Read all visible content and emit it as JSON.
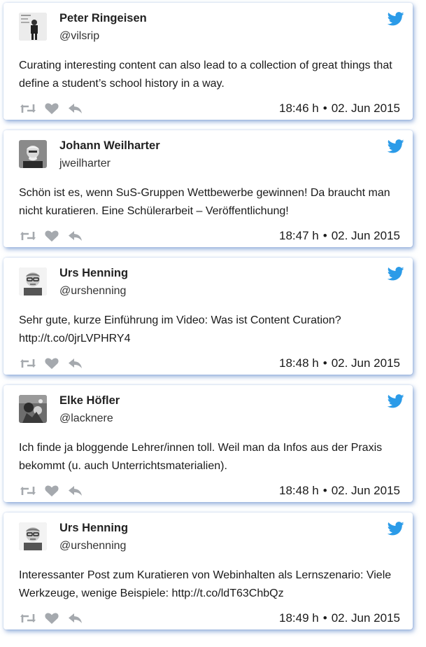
{
  "accent_color": "#2b9be8",
  "action_icon_color": "#a5a9ae",
  "icons": {
    "brand": "twitter-bird-icon",
    "actions": [
      "retweet-icon",
      "heart-icon",
      "reply-icon"
    ]
  },
  "tweets": [
    {
      "name": "Peter Ringeisen",
      "handle": "@vilsrip",
      "text": "Curating interesting content can also lead to a collection of great things that define a student’s school history in a way.",
      "time": "18:46 h",
      "date": "02. Jun 2015"
    },
    {
      "name": "Johann Weilharter",
      "handle": "jweilharter",
      "text": "Schön ist es, wenn SuS-Gruppen Wettbewerbe gewinnen! Da braucht man nicht kuratieren. Eine Schülerarbeit – Veröffentlichung!",
      "time": "18:47 h",
      "date": "02. Jun 2015"
    },
    {
      "name": "Urs Henning",
      "handle": "@urshenning",
      "text": "Sehr gute, kurze Einführung im Video: Was ist Content Curation? http://t.co/0jrLVPHRY4",
      "time": "18:48 h",
      "date": "02. Jun 2015"
    },
    {
      "name": "Elke Höfler",
      "handle": "@lacknere",
      "text": "Ich finde ja bloggende Lehrer/innen toll. Weil man da Infos aus der Praxis bekommt (u. auch Unterrichtsmaterialien).",
      "time": "18:48 h",
      "date": "02. Jun 2015"
    },
    {
      "name": "Urs Henning",
      "handle": "@urshenning",
      "text": "Interessanter Post zum Kuratieren von Webinhalten als Lernszenario: Viele Werkzeuge, wenige Beispiele: http://t.co/ldT63ChbQz",
      "time": "18:49 h",
      "date": "02. Jun 2015"
    }
  ]
}
